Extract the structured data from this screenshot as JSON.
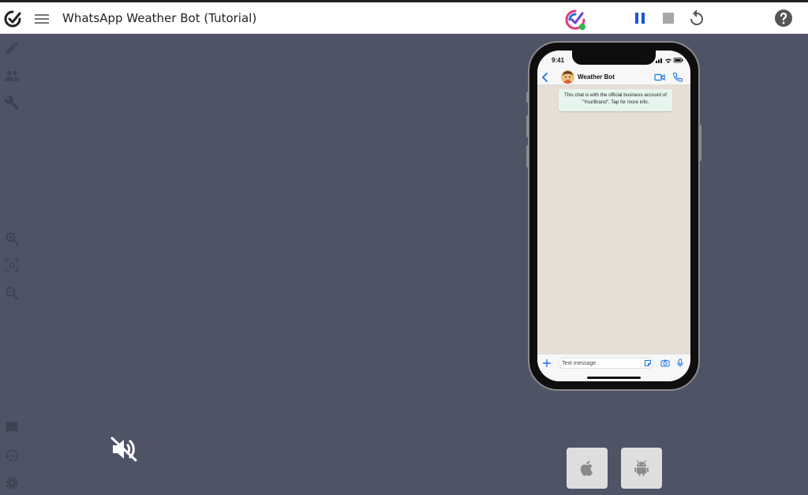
{
  "app": {
    "title": "WhatsApp Weather Bot (Tutorial)"
  },
  "toolbar": {
    "icons": [
      "logo-check-icon",
      "hamburger-menu-icon",
      "brand-logo-icon",
      "pause-icon",
      "stop-icon",
      "restart-icon",
      "help-icon"
    ]
  },
  "sidebar": {
    "top_icons": [
      "pencil-icon",
      "people-icon",
      "wrench-icon"
    ],
    "zoom_icons": [
      "zoom-in-icon",
      "fit-screen-icon",
      "zoom-out-icon"
    ],
    "bottom_icons": [
      "chat-icon",
      "history-icon",
      "settings-icon"
    ]
  },
  "phone": {
    "status_time": "9:41",
    "contact_name": "Weather Bot",
    "business_notice": "This chat is with the official business account of \"YourBrand\". Tap for more info.",
    "input_placeholder": "Text message"
  },
  "controls": {
    "mute_icon": "speaker-muted-icon",
    "platforms": [
      "apple-icon",
      "android-icon"
    ]
  },
  "colors": {
    "background": "#4f5366",
    "header": "#ffffff",
    "accent_blue": "#1a73e8",
    "notice_bubble": "#e6f6ee",
    "chat_bg": "#e5dfd6"
  }
}
